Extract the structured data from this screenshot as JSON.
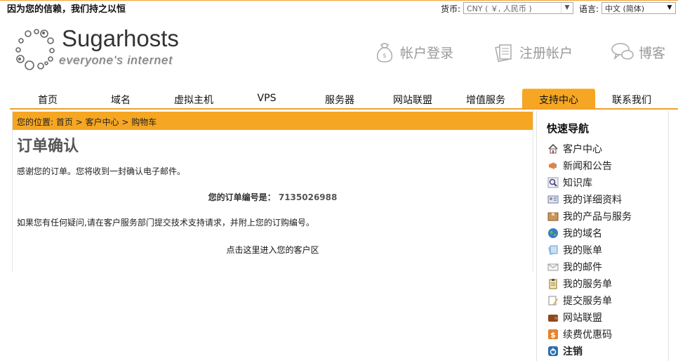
{
  "topbar": {
    "slogan": "因为您的信赖，我们持之以恒",
    "currency_label": "货币:",
    "currency_value": "CNY ( ￥, 人民币 )",
    "language_label": "语言:",
    "language_value": "中文 (简体)"
  },
  "logo": {
    "name": "Sugarhosts",
    "tagline": "everyone's internet"
  },
  "header_links": {
    "login": "帐户登录",
    "register": "注册帐户",
    "blog": "博客"
  },
  "nav": {
    "items": [
      "首页",
      "域名",
      "虚拟主机",
      "VPS",
      "服务器",
      "网站联盟",
      "增值服务",
      "支持中心",
      "联系我们"
    ],
    "active": "支持中心"
  },
  "breadcrumb": "您的位置: 首页 > 客户中心 > 购物车",
  "main": {
    "title": "订单确认",
    "thanks": "感谢您的订单。您将收到一封确认电子邮件。",
    "order_label": "您的订单编号是：",
    "order_number": "7135026988",
    "question": "如果您有任何疑问,请在客户服务部门提交技术支持请求，并附上您的订购编号。",
    "client_link": "点击这里进入您的客户区"
  },
  "sidebar": {
    "title": "快速导航",
    "items": [
      {
        "label": "客户中心",
        "icon": "home-icon"
      },
      {
        "label": "新闻和公告",
        "icon": "megaphone-icon"
      },
      {
        "label": "知识库",
        "icon": "magnifier-icon"
      },
      {
        "label": "我的详细资料",
        "icon": "id-card-icon"
      },
      {
        "label": "我的产品与服务",
        "icon": "package-icon"
      },
      {
        "label": "我的域名",
        "icon": "globe-icon"
      },
      {
        "label": "我的账单",
        "icon": "invoice-icon"
      },
      {
        "label": "我的邮件",
        "icon": "envelope-icon"
      },
      {
        "label": "我的服务单",
        "icon": "clipboard-icon"
      },
      {
        "label": "提交服务单",
        "icon": "pencil-note-icon"
      },
      {
        "label": "网站联盟",
        "icon": "wallet-icon"
      },
      {
        "label": "续费优惠码",
        "icon": "dollar-icon"
      },
      {
        "label": "注销",
        "icon": "logout-icon"
      }
    ]
  },
  "colors": {
    "accent": "#f5a623",
    "rule": "#f0a030"
  }
}
